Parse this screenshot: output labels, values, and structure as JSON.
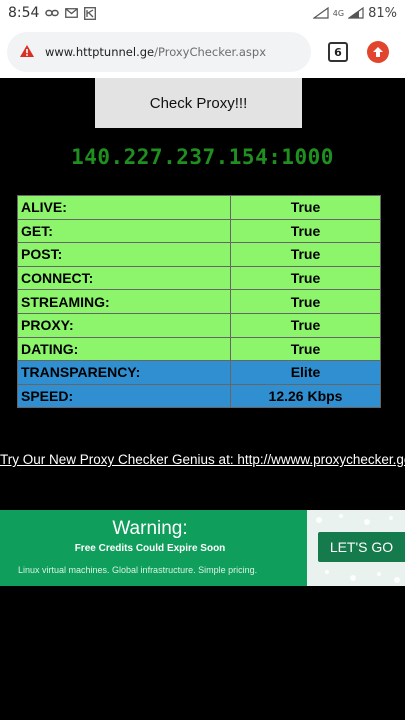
{
  "status_bar": {
    "time": "8:54",
    "network": "4G",
    "battery": "81%"
  },
  "browser": {
    "url_host": "www.httptunnel.ge",
    "url_path": "/ProxyChecker.aspx",
    "tab_count": "6"
  },
  "page": {
    "check_button": "Check Proxy!!!",
    "proxy_address": "140.227.237.154:1000",
    "results": [
      {
        "key": "ALIVE:",
        "value": "True"
      },
      {
        "key": "GET:",
        "value": "True"
      },
      {
        "key": "POST:",
        "value": "True"
      },
      {
        "key": "CONNECT:",
        "value": "True"
      },
      {
        "key": "STREAMING:",
        "value": "True"
      },
      {
        "key": "PROXY:",
        "value": "True"
      },
      {
        "key": "DATING:",
        "value": "True"
      },
      {
        "key": "TRANSPARENCY:",
        "value": "Elite"
      },
      {
        "key": "SPEED:",
        "value": "12.26 Kbps"
      }
    ],
    "promo_link": "Try Our New Proxy Checker Genius at: http://wwww.proxychecker.ge"
  },
  "ad": {
    "title": "Warning:",
    "subtitle": "Free Credits Could Expire Soon",
    "description": "Linux virtual machines. Global infrastructure. Simple pricing.",
    "cta": "LET'S GO"
  },
  "colors": {
    "green_row": "#8cf56b",
    "blue_row": "#2f8fd0",
    "ip_green": "#1f8f1f",
    "ad_green": "#0f9e5b"
  }
}
